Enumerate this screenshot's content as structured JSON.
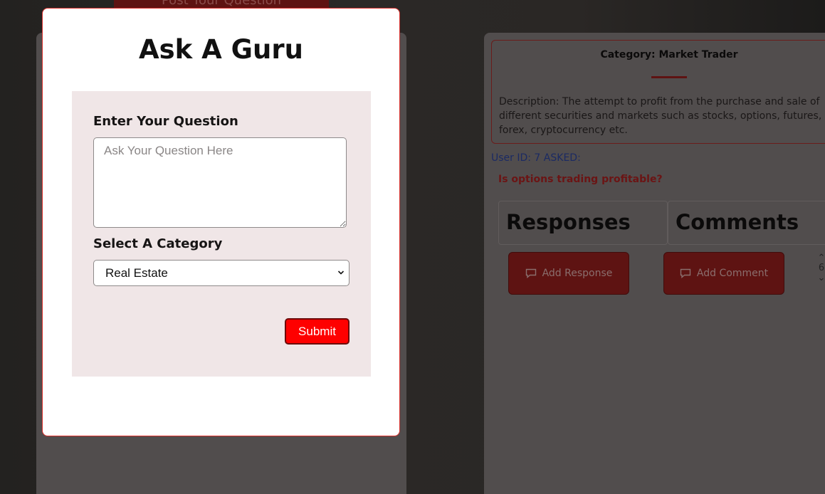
{
  "background": {
    "post_question_button": "Post Your Question",
    "category": {
      "title": "Category: Market Trader",
      "description": "Description: The attempt to profit from the purchase and sale of different securities and markets such as stocks, options, futures, forex, cryptocurrency etc."
    },
    "asked_by": "User ID: 7 ASKED:",
    "question": "Is options trading profitable?",
    "tabs": [
      "Responses",
      "Comments"
    ],
    "add_response_label": "Add Response",
    "add_comment_label": "Add Comment",
    "vote_count": "6"
  },
  "modal": {
    "title": "Ask A Guru",
    "question_label": "Enter Your Question",
    "question_placeholder": "Ask Your Question Here",
    "question_value": "",
    "category_label": "Select A Category",
    "category_selected": "Real Estate",
    "submit_label": "Submit"
  },
  "colors": {
    "submit_red": "#fe0000",
    "modal_border": "#d9302c",
    "form_panel_bg": "#f0e6e7",
    "overlay_dark": "#2b2826"
  }
}
